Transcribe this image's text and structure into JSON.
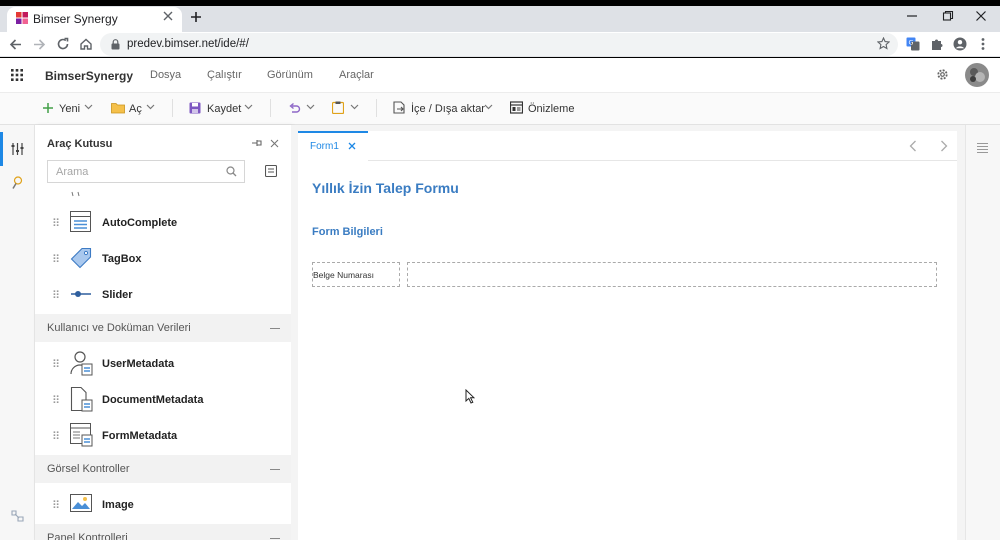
{
  "browser": {
    "tab_title": "Bimser Synergy",
    "url": "predev.bimser.net/ide/#/"
  },
  "app": {
    "name": "BimserSynergy",
    "menu": [
      "Dosya",
      "Çalıştır",
      "Görünüm",
      "Araçlar"
    ]
  },
  "toolbar": {
    "new_label": "Yeni",
    "open_label": "Aç",
    "save_label": "Kaydet",
    "import_export_label": "İçe / Dışa aktar",
    "preview_label": "Önizleme"
  },
  "toolbox": {
    "title": "Araç Kutusu",
    "search_placeholder": "Arama",
    "items_top": [
      "AutoComplete",
      "TagBox",
      "Slider"
    ],
    "category_user": "Kullanıcı ve Doküman Verileri",
    "items_user": [
      "UserMetadata",
      "DocumentMetadata",
      "FormMetadata"
    ],
    "category_visual": "Görsel Kontroller",
    "items_visual": [
      "Image"
    ],
    "category_panel": "Panel Kontrolleri"
  },
  "editor": {
    "tab_label": "Form1",
    "form_title": "Yıllık İzin Talep Formu",
    "section_title": "Form Bilgileri",
    "field_label": "Belge Numarası"
  },
  "colors": {
    "accent": "#1e88e5",
    "heading": "#3a7cc2"
  }
}
